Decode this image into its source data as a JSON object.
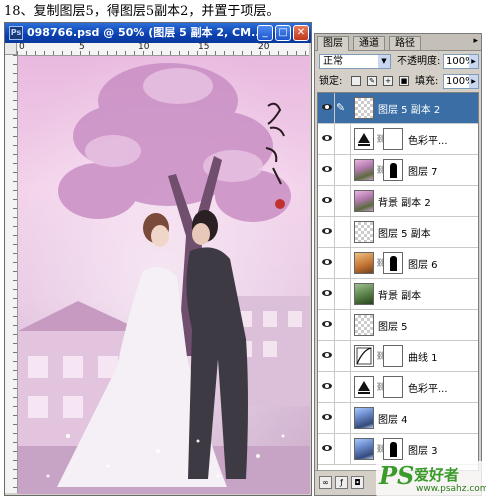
{
  "caption": "18、复制图层5，得图层5副本2，并置于项层。",
  "document": {
    "title": "098766.psd @ 50% (图层 5 副本 2, CM...",
    "ruler_labels": [
      "0",
      "5",
      "10",
      "15",
      "20"
    ]
  },
  "panel": {
    "tabs": [
      "图层",
      "通道",
      "路径"
    ],
    "blend_mode": "正常",
    "opacity_label": "不透明度:",
    "opacity_value": "100%",
    "lock_label": "锁定:",
    "fill_label": "填充:",
    "fill_value": "100%",
    "layers": [
      {
        "name": "图层 5 副本 2"
      },
      {
        "name": "色彩平..."
      },
      {
        "name": "图层 7"
      },
      {
        "name": "背景 副本 2"
      },
      {
        "name": "图层 5 副本"
      },
      {
        "name": "图层 6"
      },
      {
        "name": "背景 副本"
      },
      {
        "name": "图层 5"
      },
      {
        "name": "曲线 1"
      },
      {
        "name": "色彩平..."
      },
      {
        "name": "图层 4"
      },
      {
        "name": "图层 3"
      }
    ]
  },
  "watermark": {
    "brand": "PS",
    "name": "爱好者",
    "url": "www.psahz.com"
  }
}
